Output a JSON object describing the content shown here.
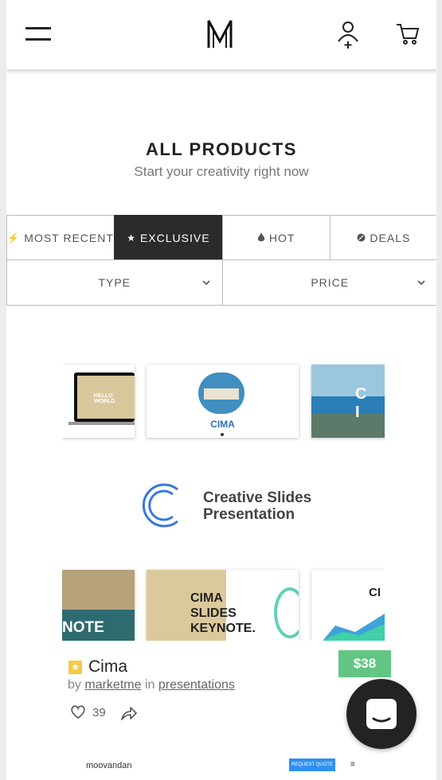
{
  "header": {
    "menu_icon": "hamburger-icon",
    "logo_text": "M",
    "account_icon": "add-user-icon",
    "cart_icon": "cart-icon"
  },
  "page": {
    "title": "ALL PRODUCTS",
    "subtitle": "Start your creativity right now"
  },
  "filters": {
    "tabs": [
      {
        "label": "MOST RECENT",
        "icon": "lightning-icon",
        "glyph": "⚡"
      },
      {
        "label": "EXCLUSIVE",
        "icon": "star-icon",
        "glyph": "★"
      },
      {
        "label": "HOT",
        "icon": "flame-icon",
        "glyph": "🔥"
      },
      {
        "label": "DEALS",
        "icon": "deal-badge-icon",
        "glyph": "●"
      }
    ],
    "active_tab": "EXCLUSIVE",
    "selects": [
      {
        "label": "TYPE"
      },
      {
        "label": "PRICE"
      }
    ]
  },
  "product": {
    "preview": {
      "slide_texts": [
        "HELLO WORLD",
        "CIMA",
        "C I",
        "NOTE",
        "CIMA SLIDES KEYNOTE.",
        "CI"
      ],
      "center_title_line1": "Creative Slides",
      "center_title_line2": "Presentation",
      "center_logo_letter": "C"
    },
    "name": "Cima",
    "exclusive_badge": "★",
    "price": "$38",
    "by_label": "by",
    "author": "marketme",
    "in_label": "in",
    "category": "presentations",
    "likes": "39"
  },
  "next_card": {
    "brand": "moovandan",
    "button": "REQUEST QUOTE",
    "menu_glyph": "≡"
  },
  "colors": {
    "active_tab_bg": "#2b2b2b",
    "price_bg": "#62c584",
    "badge": "#f6c944",
    "chat_bg": "#232323"
  }
}
